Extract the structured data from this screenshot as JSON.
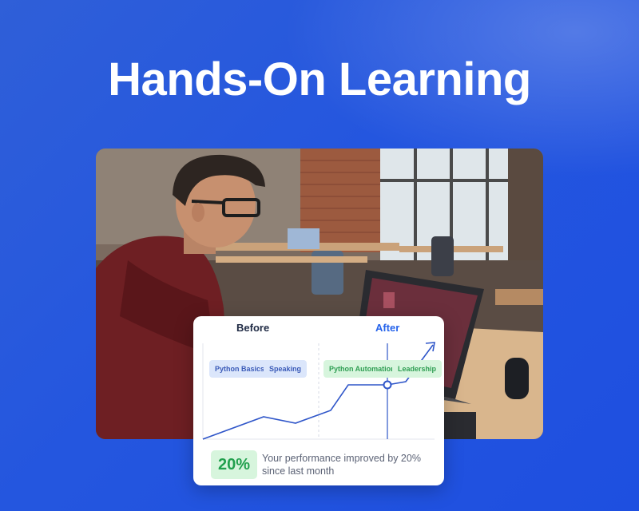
{
  "hero": {
    "title": "Hands-On Learning"
  },
  "card": {
    "before_label": "Before",
    "after_label": "After",
    "skills_before": [
      "Python Basics",
      "Speaking"
    ],
    "skills_after": [
      "Python Automation",
      "Leadership"
    ],
    "improvement_value": "20%",
    "improvement_message": "Your performance improved by 20% since last month"
  },
  "colors": {
    "background": "#2456df",
    "accent_blue": "#2563eb",
    "accent_green": "#21a04d",
    "chip_blue_bg": "#dbe6fb",
    "chip_green_bg": "#d7f5dd"
  },
  "icons": {
    "trend_arrow": "arrow-up-right-icon",
    "marker": "circle-marker-icon"
  }
}
